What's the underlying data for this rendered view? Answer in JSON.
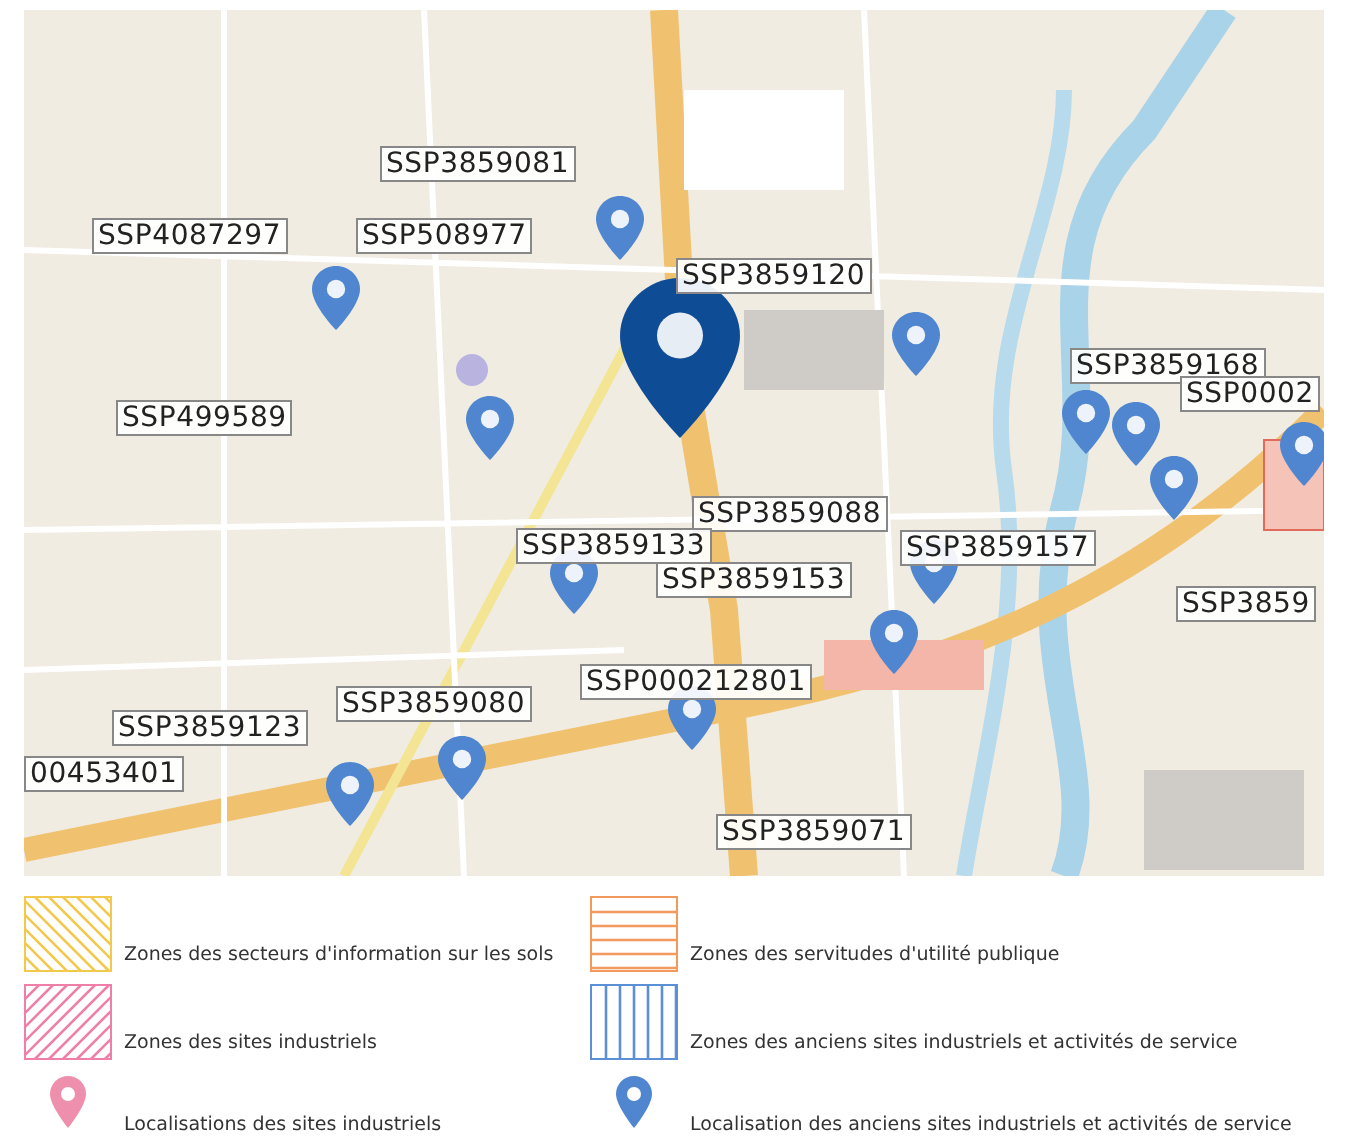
{
  "map": {
    "labels": [
      "SSP3859081",
      "SSP4087297",
      "SSP508977",
      "SSP3859120",
      "SSP3859168",
      "SSP0002",
      "SSP499589",
      "SSP3859088",
      "SSP3859133",
      "SSP3859157",
      "SSP3859153",
      "SSP3859",
      "SSP000212801",
      "SSP3859080",
      "SSP3859123",
      "00453401",
      "SSP3859071"
    ]
  },
  "legend": [
    {
      "kind": "falling",
      "color": "#f2c94c",
      "label": "Zones des secteurs d'information sur les sols"
    },
    {
      "kind": "horizontal",
      "color": "#f2995e",
      "label": "Zones des servitudes d'utilité publique"
    },
    {
      "kind": "rising",
      "color": "#ef7fa8",
      "label": "Zones des sites industriels"
    },
    {
      "kind": "vertical",
      "color": "#5b8fd6",
      "label": "Zones des anciens sites industriels et activités de service"
    },
    {
      "kind": "pin",
      "color": "#ef8fae",
      "label": "Localisations des sites industriels"
    },
    {
      "kind": "pin",
      "color": "#4f86cf",
      "label": "Localisation des anciens sites industriels et activités de service"
    }
  ]
}
